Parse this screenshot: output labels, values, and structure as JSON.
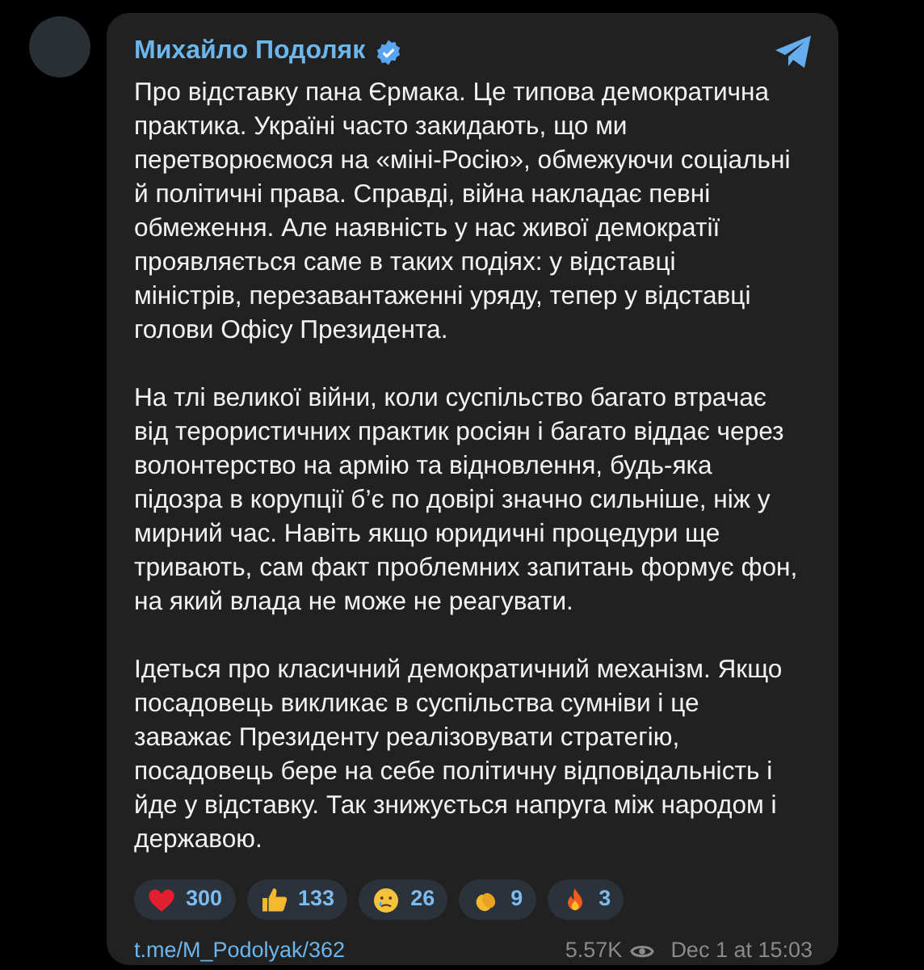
{
  "post": {
    "author": "Михайло Подоляк",
    "verified": true,
    "paragraphs": [
      [
        "Про відставку пана Єрмака. Це типова демократична",
        "практика. Україні часто закидають, що ми",
        "перетворюємося на «міні-Росію», обмежуючи соціальні",
        "й політичні права. Справді, війна накладає певні",
        "обмеження. Але наявність у нас живої демократії",
        "проявляється саме в таких подіях: у відставці",
        "міністрів, перезавантаженні уряду, тепер у відставці",
        "голови Офісу Президента."
      ],
      [
        "На тлі великої війни, коли суспільство багато втрачає",
        "від терористичних практик росіян і багато віддає через",
        "волонтерство на армію та відновлення, будь-яка",
        "підозра в корупції б’є по довірі значно сильніше, ніж у",
        "мирний час. Навіть якщо юридичні процедури ще",
        "тривають, сам факт проблемних запитань формує фон,",
        "на який влада не може не реагувати."
      ],
      [
        "Ідеться про класичний демократичний механізм. Якщо",
        "посадовець викликає в суспільства сумніви і це",
        "заважає Президенту реалізовувати стратегію,",
        "посадовець бере на себе політичну відповідальність і",
        "йде у відставку. Так знижується напруга між народом і",
        "державою."
      ]
    ],
    "reactions": [
      {
        "kind": "heart",
        "count": "300"
      },
      {
        "kind": "thumbs",
        "count": "133"
      },
      {
        "kind": "tear",
        "count": "26"
      },
      {
        "kind": "clap",
        "count": "9"
      },
      {
        "kind": "fire",
        "count": "3"
      }
    ],
    "link": "t.me/M_Podolyak/362",
    "views": "5.57K",
    "date": "Dec 1 at 15:03"
  }
}
